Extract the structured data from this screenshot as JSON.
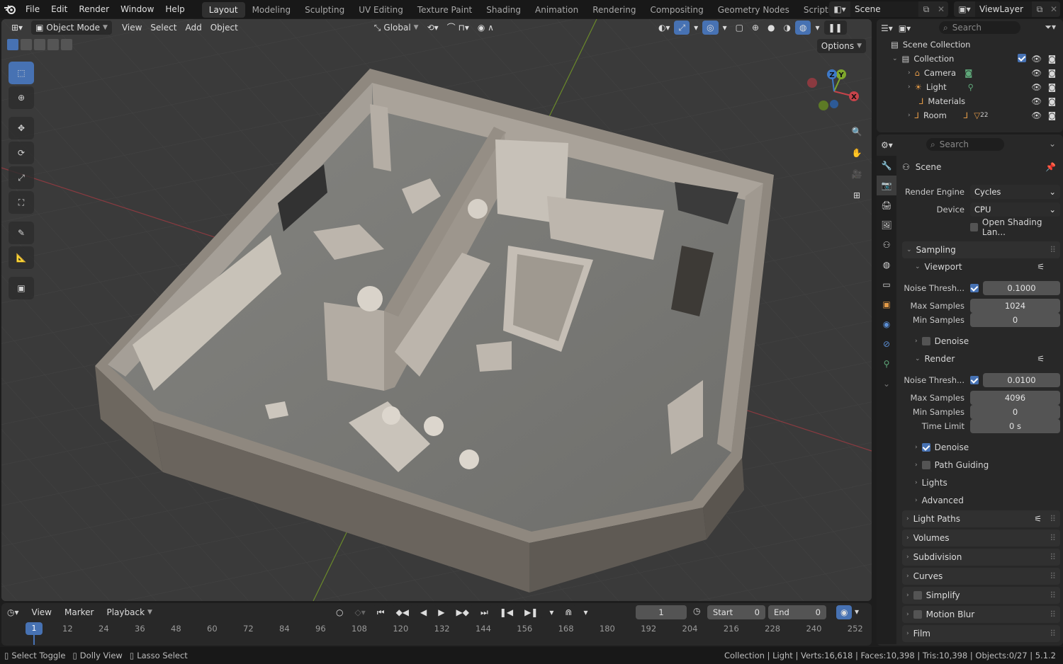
{
  "topbar": {
    "menus": [
      "File",
      "Edit",
      "Render",
      "Window",
      "Help"
    ],
    "workspaces": [
      "Layout",
      "Modeling",
      "Sculpting",
      "UV Editing",
      "Texture Paint",
      "Shading",
      "Animation",
      "Rendering",
      "Compositing",
      "Geometry Nodes",
      "Scripting"
    ],
    "active_workspace": "Layout",
    "scene_name": "Scene",
    "view_layer": "ViewLayer"
  },
  "viewport": {
    "mode": "Object Mode",
    "menus": [
      "View",
      "Select",
      "Add",
      "Object"
    ],
    "orientation": "Global",
    "options_label": "Options",
    "gizmo": {
      "x": "X",
      "y": "Y",
      "z": "Z"
    }
  },
  "outliner": {
    "search_placeholder": "Search",
    "scene_collection": "Scene Collection",
    "collection": "Collection",
    "items": [
      {
        "name": "Camera",
        "icon": "camera-icon"
      },
      {
        "name": "Light",
        "icon": "light-icon"
      },
      {
        "name": "Materials",
        "icon": "empty-icon"
      },
      {
        "name": "Room",
        "icon": "empty-icon",
        "badge": "22"
      }
    ]
  },
  "properties": {
    "search_placeholder": "Search",
    "context": "Scene",
    "render_engine_label": "Render Engine",
    "render_engine": "Cycles",
    "device_label": "Device",
    "device": "CPU",
    "open_shading_label": "Open Shading Lan...",
    "sampling": {
      "title": "Sampling",
      "viewport": {
        "title": "Viewport",
        "noise_threshold_label": "Noise Thresh...",
        "noise_threshold": "0.1000",
        "max_samples_label": "Max Samples",
        "max_samples": "1024",
        "min_samples_label": "Min Samples",
        "min_samples": "0",
        "denoise_label": "Denoise"
      },
      "render": {
        "title": "Render",
        "noise_threshold_label": "Noise Thresh...",
        "noise_threshold": "0.0100",
        "max_samples_label": "Max Samples",
        "max_samples": "4096",
        "min_samples_label": "Min Samples",
        "min_samples": "0",
        "time_limit_label": "Time Limit",
        "time_limit": "0 s",
        "denoise_label": "Denoise"
      },
      "path_guiding": "Path Guiding",
      "lights": "Lights",
      "advanced": "Advanced"
    },
    "panels": [
      "Light Paths",
      "Volumes",
      "Subdivision",
      "Curves",
      "Simplify",
      "Motion Blur",
      "Film"
    ]
  },
  "timeline": {
    "menus": [
      "View",
      "Marker",
      "Playback"
    ],
    "current_frame": "1",
    "start_label": "Start",
    "start": "0",
    "end_label": "End",
    "end": "0",
    "ticks": [
      "12",
      "24",
      "36",
      "48",
      "60",
      "72",
      "84",
      "96",
      "108",
      "120",
      "132",
      "144",
      "156",
      "168",
      "180",
      "192",
      "204",
      "216",
      "228",
      "240",
      "252"
    ]
  },
  "statusbar": {
    "hints": [
      "Select Toggle",
      "Dolly View",
      "Lasso Select"
    ],
    "stats": "Collection | Light | Verts:16,618 | Faces:10,398 | Tris:10,398 | Objects:0/27 | 5.1.2"
  },
  "colors": {
    "accent": "#4772b3",
    "x_axis": "#c7434a",
    "y_axis": "#7fa72c",
    "z_axis": "#3e79c8"
  }
}
